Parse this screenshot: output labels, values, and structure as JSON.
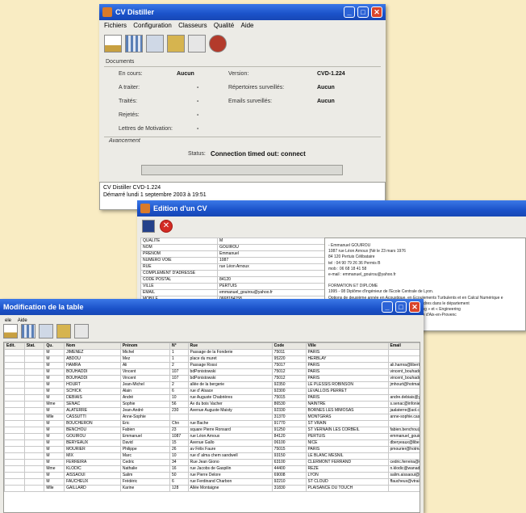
{
  "distiller": {
    "title": "CV Distiller",
    "menu": [
      "Fichiers",
      "Configuration",
      "Classeurs",
      "Qualité",
      "Aide"
    ],
    "section_documents": "Documents",
    "left_labels": [
      "En cours:",
      "A traiter:",
      "Traités:",
      "Rejetés:",
      "Lettres de Motivation:"
    ],
    "left_values": [
      "Aucun",
      "-",
      "-",
      "-",
      "-"
    ],
    "right_labels": [
      "Version:",
      "Répertoires surveillés:",
      "Emails surveillés:"
    ],
    "right_values": [
      "CVD-1.224",
      "Aucun",
      "Aucun"
    ],
    "section_progress": "Avancement",
    "status_label": "Status:",
    "status_value": "Connection timed out: connect",
    "log": [
      "CV Distiller CVD-1.224",
      "Démarré lundi 1 septembre 2003 à 19:51"
    ]
  },
  "edition": {
    "title": "Edition d'un CV",
    "fields": [
      {
        "k": "QUALITE",
        "v": "M"
      },
      {
        "k": "NOM",
        "v": "GOUIROU"
      },
      {
        "k": "PRENOM",
        "v": "Emmanuel"
      },
      {
        "k": "NUMERO VOIE",
        "v": "1087"
      },
      {
        "k": "RUE",
        "v": "rue Léon Arnoux"
      },
      {
        "k": "COMPLEMENT D'ADRESSE",
        "v": ""
      },
      {
        "k": "CODE POSTAL",
        "v": "84120"
      },
      {
        "k": "VILLE",
        "v": "PERTUIS"
      },
      {
        "k": "EMAIL",
        "v": "emmanuel_gouirou@yahoo.fr"
      },
      {
        "k": "MOBILE",
        "v": "0668184158"
      },
      {
        "k": "PERSONNEL",
        "v": "0490792636"
      },
      {
        "k": "NAISSANCE",
        "v": "23/03/1976"
      },
      {
        "k": "NATIONALITE",
        "v": ""
      }
    ],
    "text": [
      "- Emmanuel GOUIROU",
      "1087 rue Léon Arnoux (Né le 23 mars 1976",
      "84 120 Pertuis Célibataire",
      "tel : 04 90 79 26 36 Permis B",
      "mob : 06 68 18 41 58",
      "e-mail : emmanuel_gouirou@yahoo.fr",
      "",
      "FORMATION ET DIPLOME",
      "1995 - 08 Diplôme d'ingénieur de l'Ecole Centrale de Lyon.",
      "Options de deuxième année en Acoustique, en Ecoulements Turbulents et en Calcul Numérique e",
      "Deuxième année effectuée à Imperial College de Londres dans le département",
      "« Mechanical Engineering » en « Vibration Engineering » et « Engineering"
    ],
    "text_tail": "(P) au lycée Paul Cézanne d'Aix-en-Provenc"
  },
  "table": {
    "title": "Modification de la table",
    "menu": [
      "ele",
      "Aide"
    ],
    "headers": [
      "Edit.",
      "Stat.",
      "Qu.",
      "Nom",
      "Prénom",
      "N°",
      "Rue",
      "Code",
      "Ville",
      "Email"
    ],
    "rows": [
      [
        "",
        "",
        "M",
        "JIMENEZ",
        "Michel",
        "1",
        "Passage de la Fonderie",
        "75011",
        "PARIS",
        ""
      ],
      [
        "",
        "",
        "M",
        "ABDOU",
        "Mez",
        "1",
        "place du muret",
        "95220",
        "HERBLAY",
        ""
      ],
      [
        "",
        "",
        "M",
        "HAMRA",
        "Ali",
        "2",
        "Passage Rossi",
        "75017",
        "PARIS",
        "ali.hamra@libertysurf.fr"
      ],
      [
        "",
        "",
        "M",
        "BOUHADDI",
        "Vincent",
        "107",
        "bdPonistowski",
        "75012",
        "PARIS",
        "vincent_bouhaddi@yahoo.fr"
      ],
      [
        "",
        "",
        "M",
        "BOUHADDI",
        "Vincent",
        "107",
        "bdPonistowski",
        "75012",
        "PARIS",
        "vincent_bouhaddi@yahoo.fr"
      ],
      [
        "",
        "",
        "M",
        "HOURT",
        "Jean-Michel",
        "2",
        "allée de la bergerie",
        "92350",
        "LE PLESSIS ROBINSON",
        "jmhourt@hotmail.com"
      ],
      [
        "",
        "",
        "M",
        "SCHICK",
        "Alain",
        "6",
        "rue d' Alsace",
        "92300",
        "LEVALLOIS PERRET",
        ""
      ],
      [
        "",
        "",
        "M",
        "DEBIAIS",
        "André",
        "10",
        "rue Auguste Chabrières",
        "75015",
        "PARIS",
        "andre.debiais@yahoo.fr"
      ],
      [
        "",
        "",
        "Mme",
        "SENAC",
        "Sophie",
        "56",
        "Av du bois Vacher",
        "86530",
        "NAINTRE",
        "s.senac@infonie.fr"
      ],
      [
        "",
        "",
        "M",
        "ALATERRE",
        "Jean-André",
        "230",
        "Avenue Auguste Maisty",
        "92330",
        "BORNES LES MIMOSAS",
        "jaalaterre@aol.com"
      ],
      [
        "",
        "",
        "Mlle",
        "CASSUTTI",
        "Anne-Sophie",
        "",
        "",
        "31370",
        "MONTGRAS",
        "anne-sophie.cassutti@wanadoo.fr"
      ],
      [
        "",
        "",
        "M",
        "BOUCHERON",
        "Eric",
        "Chn",
        "rue Bache",
        "91770",
        "ST VRAIN",
        ""
      ],
      [
        "",
        "",
        "M",
        "BENCHOU",
        "Fabien",
        "23",
        "square Pierre Ronsard",
        "91250",
        "ST VERNAIN LES CORBEIL",
        "fabien.benchou@yahoo.fr"
      ],
      [
        "",
        "",
        "M",
        "GOUIROU",
        "Emmanuel",
        "1087",
        "rue Léon Arnoux",
        "84120",
        "PERTUIS",
        "emmanuel_gouirou@yahoo.fr"
      ],
      [
        "",
        "",
        "M",
        "BERYEAUX",
        "David",
        "15",
        "Avenue Gallo",
        "06100",
        "NICE",
        "dberyeaux@libertysurf.fr"
      ],
      [
        "",
        "",
        "M",
        "MOURIER",
        "Philippe",
        "26",
        "av Félix Faure",
        "75015",
        "PARIS",
        "pmourier@hotmail.com"
      ],
      [
        "",
        "",
        "M",
        "MIX",
        "Marc",
        "10",
        "rue d' alma chem sandwell",
        "93150",
        "LE BLANC MESNIL",
        ""
      ],
      [
        "",
        "",
        "M",
        "FERREIRA",
        "Cedric",
        "34",
        "Rue Jean Giono",
        "63100",
        "CLERMONT FERRAND",
        "cedric.ferreira@wanadoo.fr"
      ],
      [
        "",
        "",
        "Mme",
        "KLODIC",
        "Nathalie",
        "16",
        "rue Jacobs de Gaspilin",
        "44400",
        "REZE",
        "n.klodic@wanadoo.fr"
      ],
      [
        "",
        "",
        "M",
        "AISSAOUI",
        "Salim",
        "50",
        "rue Pierre Delore",
        "69008",
        "LYON",
        "salim.aissaoui@caramail.com"
      ],
      [
        "",
        "",
        "M",
        "FAUCHEUX",
        "Frédéric",
        "6",
        "rue Ferdinand Charbon",
        "92210",
        "ST CLOUD",
        "ffaucheux@vtrain.fr"
      ],
      [
        "",
        "",
        "Mlle",
        "GAILLARD",
        "Karine",
        "128",
        "Allée Montaigne",
        "31830",
        "PLAISANCE DU TOUCH",
        ""
      ]
    ]
  }
}
